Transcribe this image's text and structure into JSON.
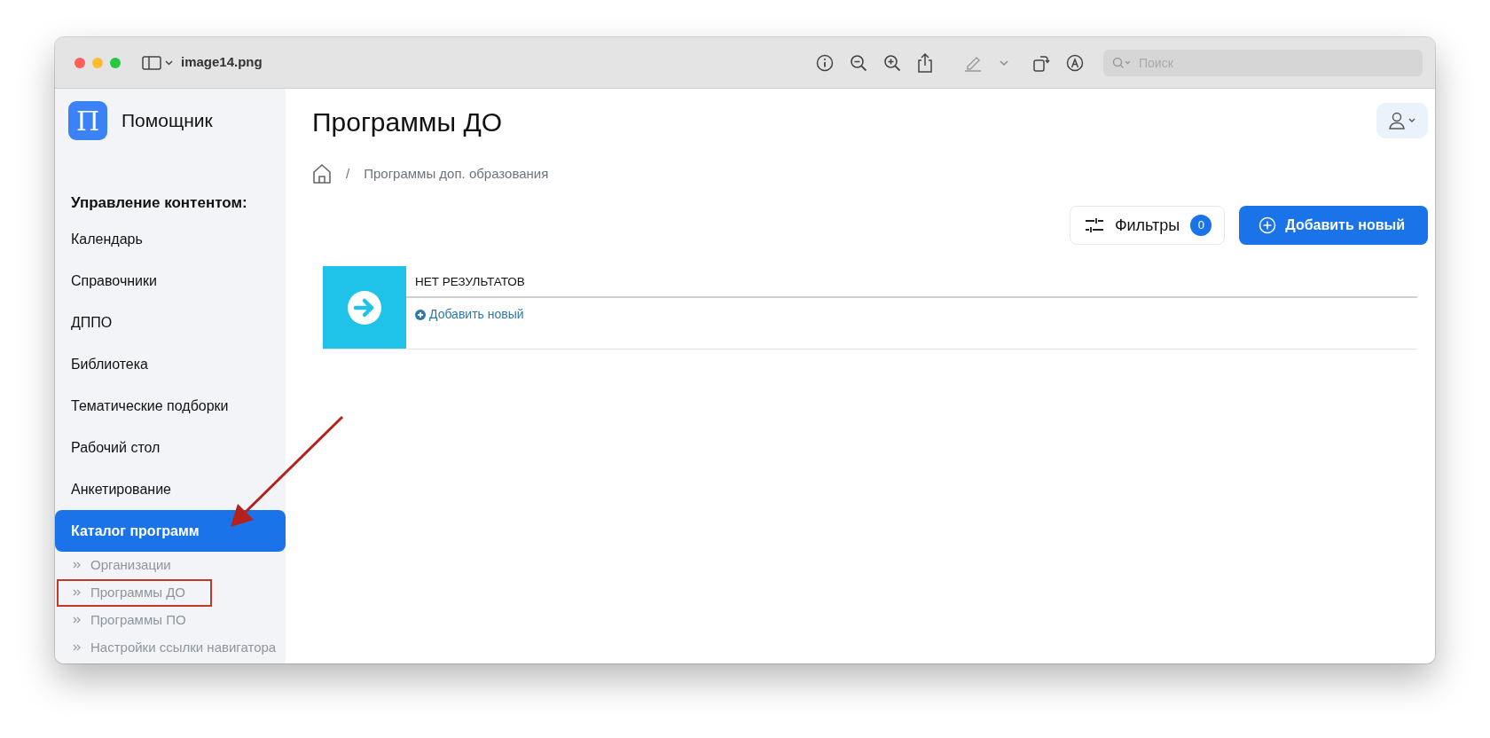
{
  "window": {
    "title": "image14.png"
  },
  "toolbar": {
    "search": {
      "placeholder": "Поиск"
    }
  },
  "sidebar": {
    "brand": {
      "letter": "П",
      "name": "Помощник"
    },
    "heading": "Управление контентом:",
    "items": [
      {
        "label": "Календарь",
        "selected": false
      },
      {
        "label": "Справочники",
        "selected": false
      },
      {
        "label": "ДППО",
        "selected": false
      },
      {
        "label": "Библиотека",
        "selected": false
      },
      {
        "label": "Тематические подборки",
        "selected": false
      },
      {
        "label": "Рабочий стол",
        "selected": false
      },
      {
        "label": "Анкетирование",
        "selected": false
      },
      {
        "label": "Каталог программ",
        "selected": true
      }
    ],
    "subitems": [
      {
        "label": "Организации",
        "annotated": false
      },
      {
        "label": "Программы ДО",
        "annotated": true
      },
      {
        "label": "Программы ПО",
        "annotated": false
      },
      {
        "label": "Настройки ссылки навигатора",
        "annotated": false
      }
    ]
  },
  "page": {
    "title": "Программы ДО",
    "breadcrumb_separator": "/",
    "breadcrumb": "Программы доп. образования",
    "filters": {
      "label": "Фильтры",
      "count": "0"
    },
    "add_button": "Добавить новый",
    "results": {
      "heading": "НЕТ РЕЗУЛЬТАТОВ",
      "link": "Добавить новый"
    }
  },
  "annotation": {
    "arrow": true
  }
}
